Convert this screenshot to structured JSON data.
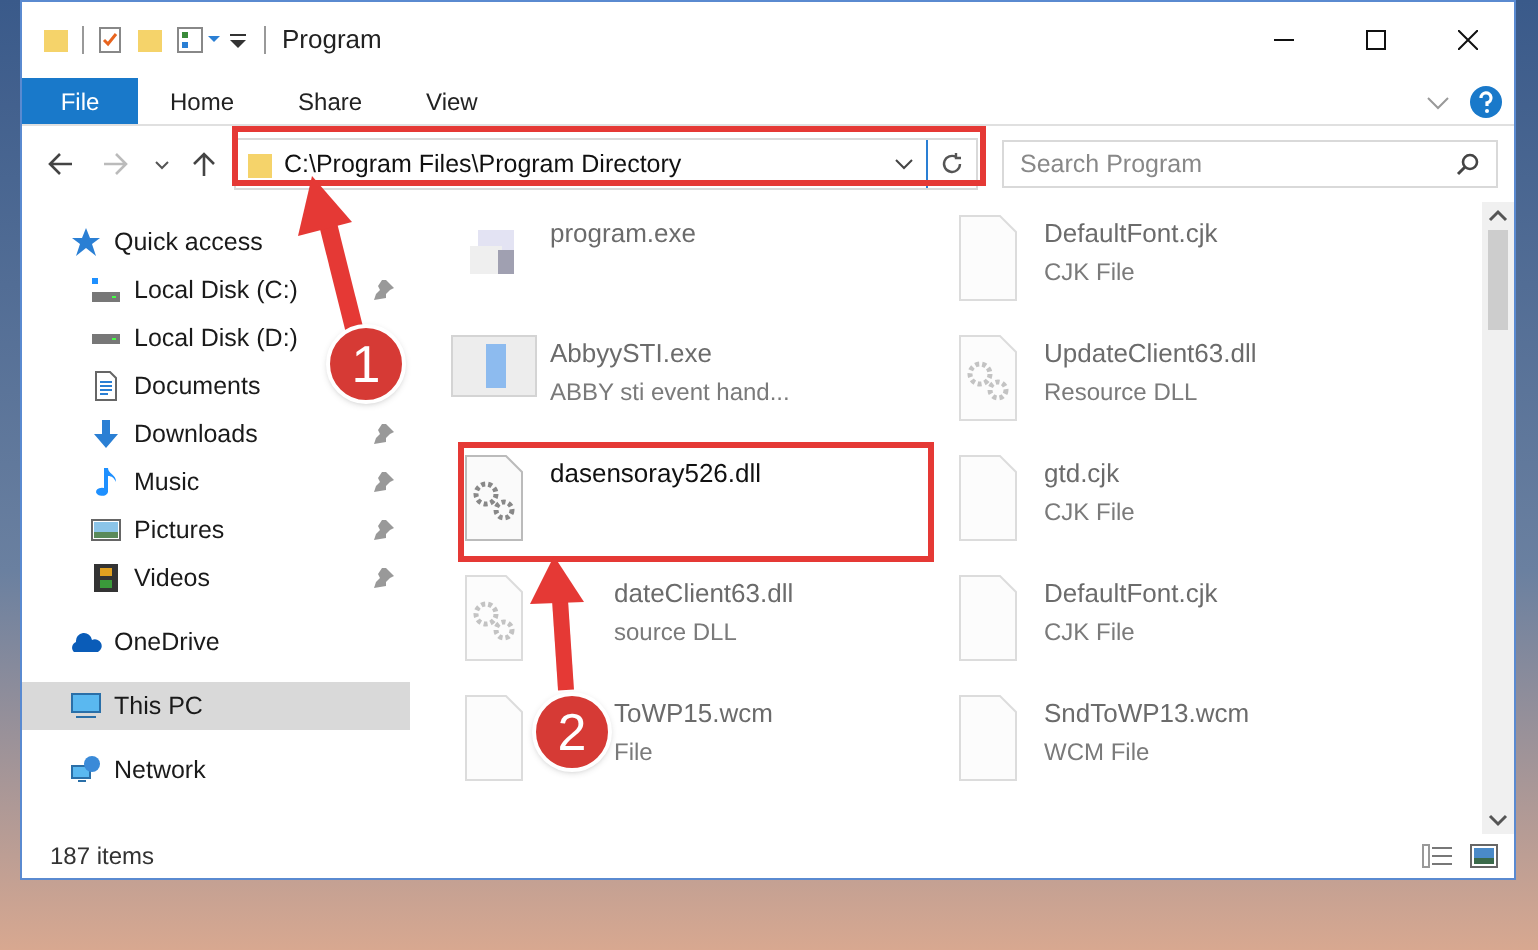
{
  "window": {
    "title": "Program"
  },
  "ribbon_tabs": [
    {
      "label": "File",
      "selected": true
    },
    {
      "label": "Home",
      "selected": false
    },
    {
      "label": "Share",
      "selected": false
    },
    {
      "label": "View",
      "selected": false
    }
  ],
  "address": {
    "path": "C:\\Program Files\\Program Directory"
  },
  "search": {
    "placeholder": "Search Program"
  },
  "nav": [
    {
      "label": "Quick access",
      "kind": "star",
      "selected": false,
      "children": [
        {
          "label": "Local Disk (C:)",
          "kind": "disk-c",
          "pinned": true,
          "selected": false
        },
        {
          "label": "Local Disk (D:)",
          "kind": "disk",
          "pinned": false,
          "selected": false
        },
        {
          "label": "Documents",
          "kind": "documents",
          "pinned": false,
          "selected": false
        },
        {
          "label": "Downloads",
          "kind": "downloads",
          "pinned": true,
          "selected": false
        },
        {
          "label": "Music",
          "kind": "music",
          "pinned": true,
          "selected": false
        },
        {
          "label": "Pictures",
          "kind": "pictures",
          "pinned": true,
          "selected": false
        },
        {
          "label": "Videos",
          "kind": "videos",
          "pinned": true,
          "selected": false
        }
      ]
    },
    {
      "label": "OneDrive",
      "kind": "cloud",
      "selected": false
    },
    {
      "label": "This PC",
      "kind": "pc",
      "selected": true
    },
    {
      "label": "Network",
      "kind": "network",
      "selected": false
    }
  ],
  "files": [
    {
      "name": "program.exe",
      "kind": "installer",
      "blurred": true
    },
    {
      "name": "DefaultFont.cjk",
      "type": "CJK File",
      "kind": "blank",
      "blurred": true
    },
    {
      "name": "AbbyySTI.exe",
      "type": "ABBY sti event hand...",
      "kind": "app",
      "blurred": true
    },
    {
      "name": "UpdateClient63.dll",
      "type": "Resource DLL",
      "kind": "gears-blurred",
      "blurred": true
    },
    {
      "name": "dasensoray526.dll",
      "kind": "gears",
      "blurred": false
    },
    {
      "name": "gtd.cjk",
      "type": "CJK File",
      "kind": "blank",
      "blurred": true
    },
    {
      "name": "dateClient63.dll",
      "type": "source DLL",
      "kind": "gears-blurred",
      "blurred": true,
      "partly_hidden": true
    },
    {
      "name": "DefaultFont.cjk",
      "type": "CJK File",
      "kind": "blank",
      "blurred": true
    },
    {
      "name": "ToWP15.wcm",
      "type": "File",
      "kind": "blank",
      "blurred": true,
      "partly_hidden": true
    },
    {
      "name": "SndToWP13.wcm",
      "type": "WCM File",
      "kind": "blank",
      "blurred": true
    }
  ],
  "callouts": [
    {
      "number": "1"
    },
    {
      "number": "2"
    }
  ],
  "status_bar": {
    "count": "187 items"
  }
}
